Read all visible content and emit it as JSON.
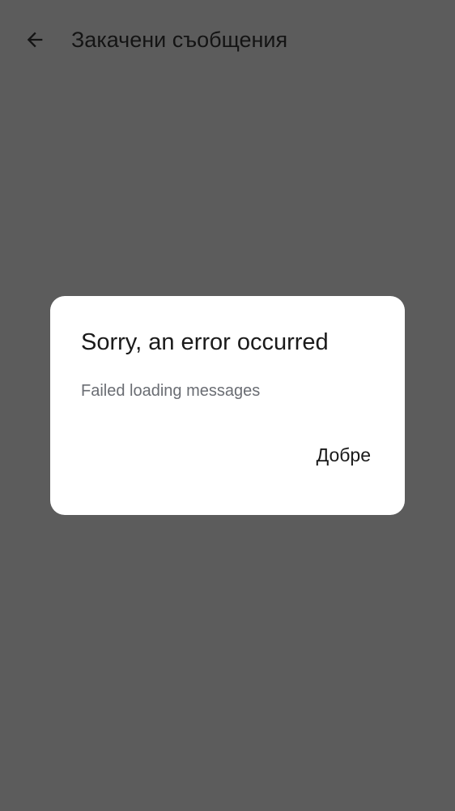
{
  "app_bar": {
    "back_icon": "arrow-back-icon",
    "title": "Закачени съобщения"
  },
  "dialog": {
    "title": "Sorry, an error occurred",
    "message": "Failed loading messages",
    "ok_label": "Добре"
  },
  "colors": {
    "scrim_background": "#5c5c5c",
    "dialog_background": "#ffffff",
    "title_text": "#1a1a1a",
    "message_text": "#6a6d73"
  }
}
